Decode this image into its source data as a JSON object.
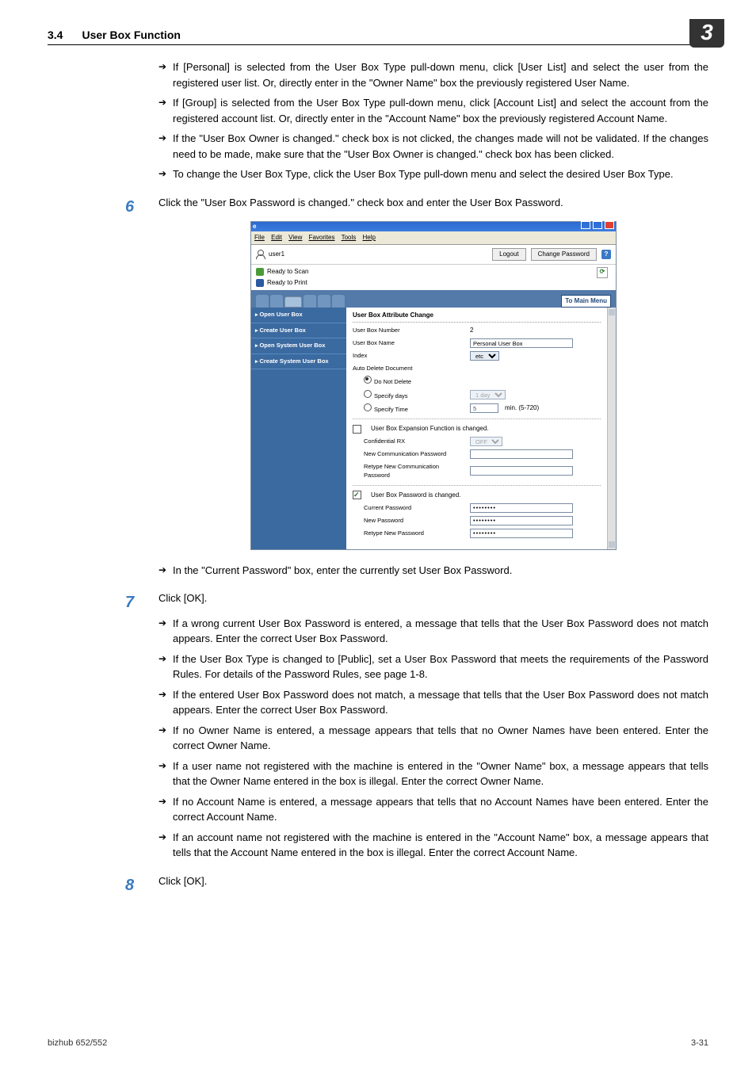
{
  "header": {
    "section": "3.4",
    "title": "User Box Function",
    "chapter": "3"
  },
  "bulletsA": [
    "If [Personal] is selected from the User Box Type pull-down menu, click [User List] and select the user from the registered user list. Or, directly enter in the \"Owner Name\" box the previously registered User Name.",
    "If [Group] is selected from the User Box Type pull-down menu, click [Account List] and select the account from the registered account list. Or, directly enter in the \"Account Name\" box the previously registered Account Name.",
    "If the \"User Box Owner is changed.\" check box is not clicked, the changes made will not be validated. If the changes need to be made, make sure that the \"User Box Owner is changed.\" check box has been clicked.",
    "To change the User Box Type, click the User Box Type pull-down menu and select the desired User Box Type."
  ],
  "step6": {
    "num": "6",
    "text": "Click the \"User Box Password is changed.\" check box and enter the User Box Password."
  },
  "bullets6": [
    "In the \"Current Password\" box, enter the currently set User Box Password."
  ],
  "step7": {
    "num": "7",
    "text": "Click [OK]."
  },
  "bullets7": [
    "If a wrong current User Box Password is entered, a message that tells that the User Box Password does not match appears. Enter the correct User Box Password.",
    "If the User Box Type is changed to [Public], set a User Box Password that meets the requirements of the Password Rules. For details of the Password Rules, see page 1-8.",
    "If the entered User Box Password does not match, a message that tells that the User Box Password does not match appears. Enter the correct User Box Password.",
    "If no Owner Name is entered, a message appears that tells that no Owner Names have been entered. Enter the correct Owner Name.",
    "If a user name not registered with the machine is entered in the \"Owner Name\" box, a message appears that tells that the Owner Name entered in the box is illegal. Enter the correct Owner Name.",
    "If no Account Name is entered, a message appears that tells that no Account Names have been entered. Enter the correct Account Name.",
    "If an account name not registered with the machine is entered in the \"Account Name\" box, a message appears that tells that the Account Name entered in the box is illegal. Enter the correct Account Name."
  ],
  "step8": {
    "num": "8",
    "text": "Click [OK]."
  },
  "footer": {
    "left": "bizhub 652/552",
    "right": "3-31"
  },
  "shot": {
    "menubar": [
      "File",
      "Edit",
      "View",
      "Favorites",
      "Tools",
      "Help"
    ],
    "user": "user1",
    "buttons": {
      "logout": "Logout",
      "changepw": "Change Password"
    },
    "status": {
      "scan": "Ready to Scan",
      "print": "Ready to Print"
    },
    "tomain": "To Main Menu",
    "side": [
      "Open User Box",
      "Create User Box",
      "Open System User Box",
      "Create System User Box"
    ],
    "mtitle": "User Box Attribute Change",
    "rows": {
      "ubnum_l": "User Box Number",
      "ubnum_v": "2",
      "ubname_l": "User Box Name",
      "ubname_v": "Personal User Box",
      "index_l": "Index",
      "index_v": "etc",
      "autodel_l": "Auto Delete Document",
      "r_dnd": "Do Not Delete",
      "r_sd": "Specify days",
      "r_sd_v": "1 day",
      "r_st": "Specify Time",
      "r_st_v": "5",
      "r_st_u": "min. (5-720)",
      "chk_exp": "User Box Expansion Function is changed.",
      "conf_l": "Confidential RX",
      "conf_v": "OFF",
      "ncp_l": "New Communication Password",
      "rncp_l": "Retype New Communication Password",
      "chk_pw": "User Box Password is changed.",
      "cpw_l": "Current Password",
      "cpw_v": "••••••••",
      "npw_l": "New Password",
      "npw_v": "••••••••",
      "rnpw_l": "Retype New Password",
      "rnpw_v": "••••••••"
    }
  }
}
